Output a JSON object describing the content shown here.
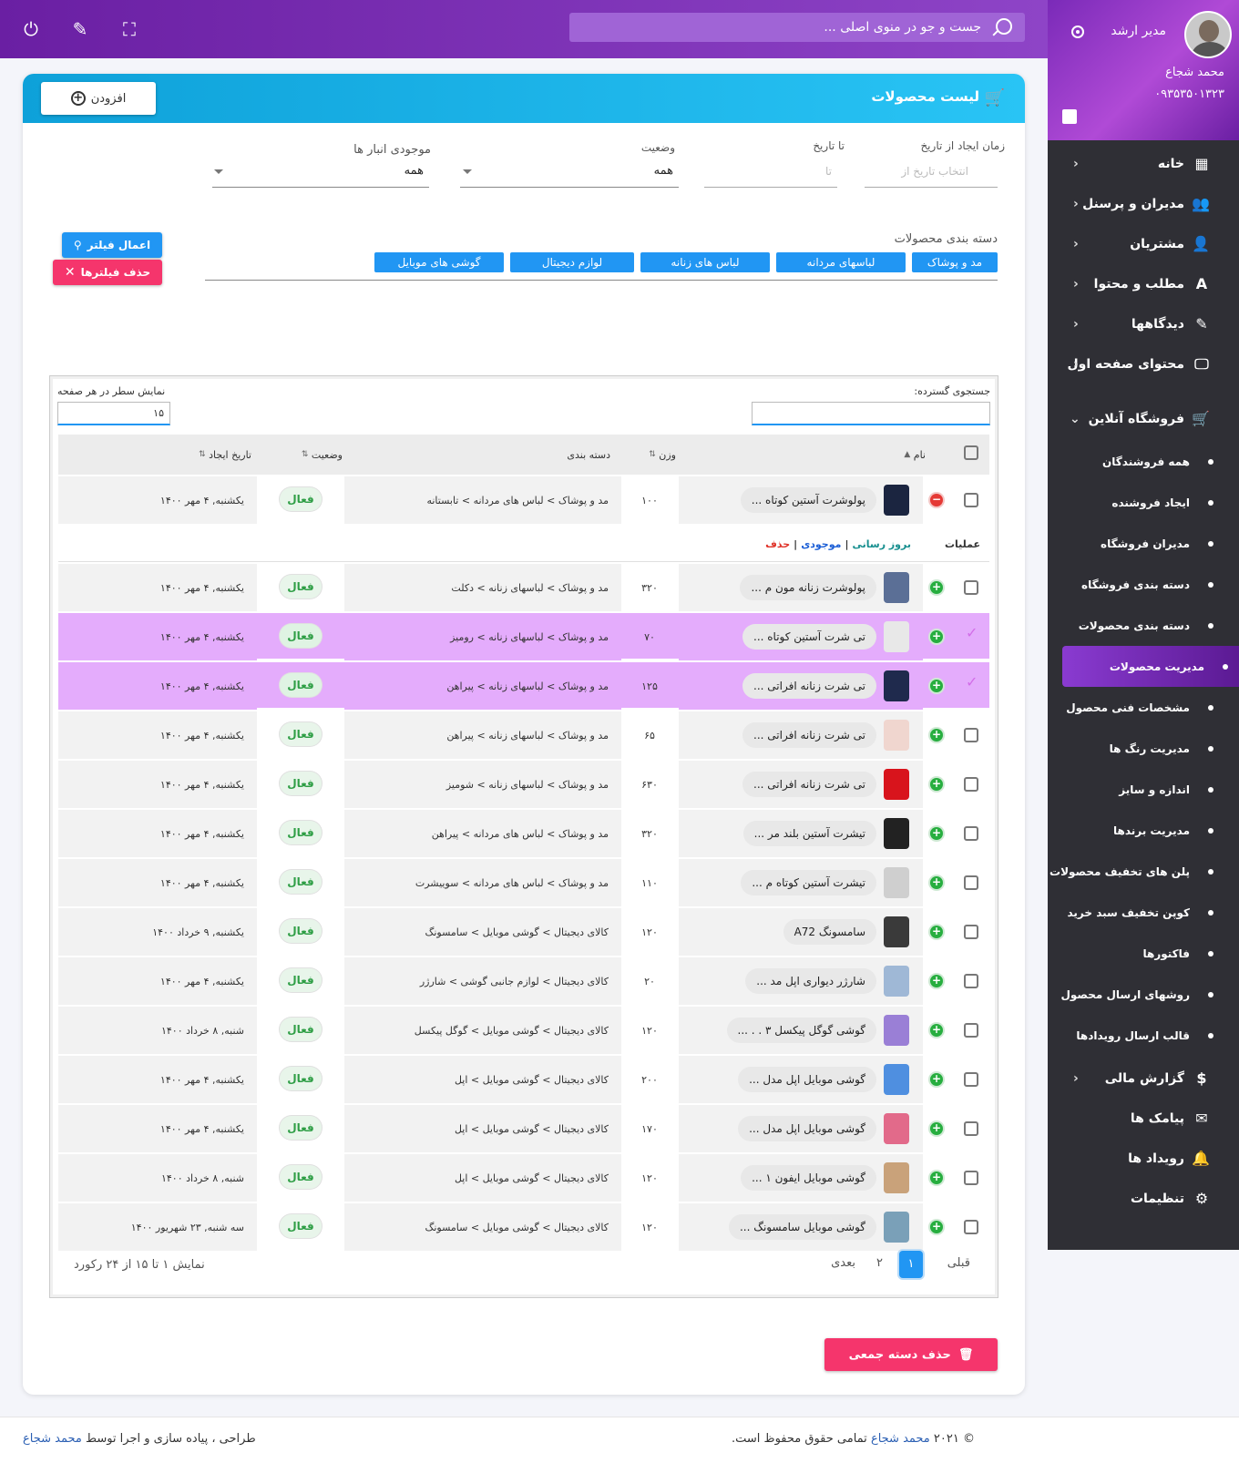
{
  "sidebar": {
    "role": "مدیر ارشد",
    "user_name": "محمد شجاع",
    "phone": "۰۹۳۵۳۵۰۱۳۲۳",
    "menu": [
      {
        "label": "خانه",
        "icon": "dashboard-icon"
      },
      {
        "label": "مدیران و پرسنل",
        "icon": "group-icon"
      },
      {
        "label": "مشتریان",
        "icon": "people-icon"
      },
      {
        "label": "مطلب و محتوا",
        "icon": "text-icon"
      },
      {
        "label": "دیدگاهها",
        "icon": "comment-icon"
      },
      {
        "label": "محتوای صفحه اول",
        "icon": "monitor-icon"
      }
    ],
    "shop": {
      "label": "فروشگاه آنلاین",
      "icon": "cart-icon"
    },
    "shop_items": [
      "همه فروشندگان",
      "ایجاد فروشنده",
      "مدیران فروشگاه",
      "دسته بندی فروشگاه",
      "دسته بندی محصولات",
      "مدیریت محصولات",
      "مشخصات فنی محصول",
      "مدیریت رنگ ها",
      "اندازه و سایز",
      "مدیریت برندها",
      "پلن های تخفیف محصولات",
      "کوپن تخفیف سبد خرید",
      "فاکتورها",
      "روشهای ارسال محصول",
      "قالب ارسال رویدادها"
    ],
    "active_item": "مدیریت محصولات",
    "bottom": [
      {
        "label": "گزارش مالی",
        "icon": "dollar-icon"
      },
      {
        "label": "پیامک ها",
        "icon": "sms-icon"
      },
      {
        "label": "رویداد ها",
        "icon": "bell-icon"
      },
      {
        "label": "تنظیمات",
        "icon": "settings-icon"
      }
    ]
  },
  "topbar": {
    "search_placeholder": "جست و جو در منوی اصلی ..."
  },
  "page": {
    "title": "لیست محصولات",
    "add_label": "افزودن"
  },
  "filters": {
    "created_from_label": "زمان ایجاد از تاریخ",
    "created_from_ph": "انتخاب تاریخ از",
    "to_label": "تا تاریخ",
    "to_ph": "تا",
    "status_label": "وضعیت",
    "status_value": "همه",
    "stock_label": "موجودی انبار ها",
    "stock_value": "همه",
    "category_label": "دسته بندی محصولات",
    "categories": [
      "مد و پوشاک",
      "لباسهای مردانه",
      "لباس های زنانه",
      "لوازم دیجیتال",
      "گوشی های موبایل"
    ],
    "apply_label": "اعمال فیلتر",
    "clear_label": "حذف فیلترها"
  },
  "table": {
    "search_label": "جستجوی گسترده:",
    "per_page_label": "نمایش سطر در هر صفحه",
    "per_page_value": "۱۵",
    "headers": {
      "name": "نام",
      "weight": "وزن",
      "category": "دسته بندی",
      "status": "وضعیت",
      "date": "تاریخ ایجاد"
    },
    "ops_label": "عملیات",
    "ops": {
      "update": "بروز رسانی",
      "stock": "موجودی",
      "delete": "حذف",
      "sep": "|"
    },
    "rows": [
      {
        "name": "پولوشرت آستین کوتاه ...",
        "weight": "۱۰۰",
        "category": "مد و پوشاک > لباس های مردانه > تابستانه",
        "status": "فعال",
        "date": "یکشنبه, ۴ مهر ۱۴۰۰",
        "thumb": "#1b2540",
        "selected": false,
        "expanded": true
      },
      {
        "name": "پولوشرت زنانه مون م ...",
        "weight": "۳۲۰",
        "category": "مد و پوشاک > لباسهای زنانه > دکلت",
        "status": "فعال",
        "date": "یکشنبه, ۴ مهر ۱۴۰۰",
        "thumb": "#5b6f96",
        "selected": false
      },
      {
        "name": "تی شرت آستین کوتاه ...",
        "weight": "۷۰",
        "category": "مد و پوشاک > لباسهای زنانه > رومیز",
        "status": "فعال",
        "date": "یکشنبه, ۴ مهر ۱۴۰۰",
        "thumb": "#e8e8e8",
        "selected": true
      },
      {
        "name": "تی شرت زنانه افراتی ...",
        "weight": "۱۲۵",
        "category": "مد و پوشاک > لباسهای زنانه > پیراهن",
        "status": "فعال",
        "date": "یکشنبه, ۴ مهر ۱۴۰۰",
        "thumb": "#1f2a4d",
        "selected": true
      },
      {
        "name": "تی شرت زنانه افراتی ...",
        "weight": "۶۵",
        "category": "مد و پوشاک > لباسهای زنانه > پیراهن",
        "status": "فعال",
        "date": "یکشنبه, ۴ مهر ۱۴۰۰",
        "thumb": "#f0d6cf",
        "selected": false
      },
      {
        "name": "تی شرت زنانه افراتی ...",
        "weight": "۶۳۰",
        "category": "مد و پوشاک > لباسهای زنانه > شومیز",
        "status": "فعال",
        "date": "یکشنبه, ۴ مهر ۱۴۰۰",
        "thumb": "#d8141c",
        "selected": false
      },
      {
        "name": "تیشرت آستین بلند مر ...",
        "weight": "۳۲۰",
        "category": "مد و پوشاک > لباس های مردانه > پیراهن",
        "status": "فعال",
        "date": "یکشنبه, ۴ مهر ۱۴۰۰",
        "thumb": "#222222",
        "selected": false
      },
      {
        "name": "تیشرت آستین کوتاه م ...",
        "weight": "۱۱۰",
        "category": "مد و پوشاک > لباس های مردانه > سوییشرت",
        "status": "فعال",
        "date": "یکشنبه, ۴ مهر ۱۴۰۰",
        "thumb": "#cfcfcf",
        "selected": false
      },
      {
        "name": "سامسونگ A72",
        "weight": "۱۲۰",
        "category": "کالای دیجیتال > گوشی موبایل > سامسونگ",
        "status": "فعال",
        "date": "یکشنبه, ۹ خرداد ۱۴۰۰",
        "thumb": "#3a3a3a",
        "selected": false
      },
      {
        "name": "شارژر دیواری اپل مد ...",
        "weight": "۲۰",
        "category": "کالای دیجیتال > لوازم جانبی گوشی > شارژر",
        "status": "فعال",
        "date": "یکشنبه, ۴ مهر ۱۴۰۰",
        "thumb": "#9fb8d6",
        "selected": false
      },
      {
        "name": "گوشی گوگل پیکسل ۳ . . ...",
        "weight": "۱۲۰",
        "category": "کالای دیجیتال > گوشی موبایل > گوگل پیکسل",
        "status": "فعال",
        "date": "شنبه, ۸ خرداد ۱۴۰۰",
        "thumb": "#9a7fd6",
        "selected": false
      },
      {
        "name": "گوشی موبایل اپل مدل ...",
        "weight": "۲۰۰",
        "category": "کالای دیجیتال > گوشی موبایل > اپل",
        "status": "فعال",
        "date": "یکشنبه, ۴ مهر ۱۴۰۰",
        "thumb": "#4f8fe0",
        "selected": false
      },
      {
        "name": "گوشی موبایل اپل مدل ...",
        "weight": "۱۷۰",
        "category": "کالای دیجیتال > گوشی موبایل > اپل",
        "status": "فعال",
        "date": "یکشنبه, ۴ مهر ۱۴۰۰",
        "thumb": "#e26a8a",
        "selected": false
      },
      {
        "name": "گوشی موبایل ایفون ۱ ...",
        "weight": "۱۲۰",
        "category": "کالای دیجیتال > گوشی موبایل > اپل",
        "status": "فعال",
        "date": "شنبه, ۸ خرداد ۱۴۰۰",
        "thumb": "#c9a27a",
        "selected": false
      },
      {
        "name": "گوشی موبایل سامسونگ ...",
        "weight": "۱۲۰",
        "category": "کالای دیجیتال > گوشی موبایل > سامسونگ",
        "status": "فعال",
        "date": "سه شنبه, ۲۳ شهریور ۱۴۰۰",
        "thumb": "#7aa0b8",
        "selected": false
      }
    ],
    "info": "نمایش ۱ تا ۱۵ از ۲۴ رکورد",
    "pagination": {
      "prev": "قبلی",
      "p1": "۱",
      "p2": "۲",
      "next": "بعدی"
    },
    "bulk_delete": "حذف دسته جمعی"
  },
  "footer": {
    "left_text": "طراحی ، پیاده سازی و اجرا توسط",
    "left_author": "محمد شجاع",
    "right_prefix": "© ۲۰۲۱",
    "right_author": "محمد شجاع",
    "right_text": "تمامی حقوق محفوظ است."
  },
  "colors": {
    "primary": "#2196f3",
    "accent_purple": "#7a2ab8",
    "danger": "#f5356c",
    "selected_row": "#e4acfc",
    "success": "#27ae3f"
  }
}
